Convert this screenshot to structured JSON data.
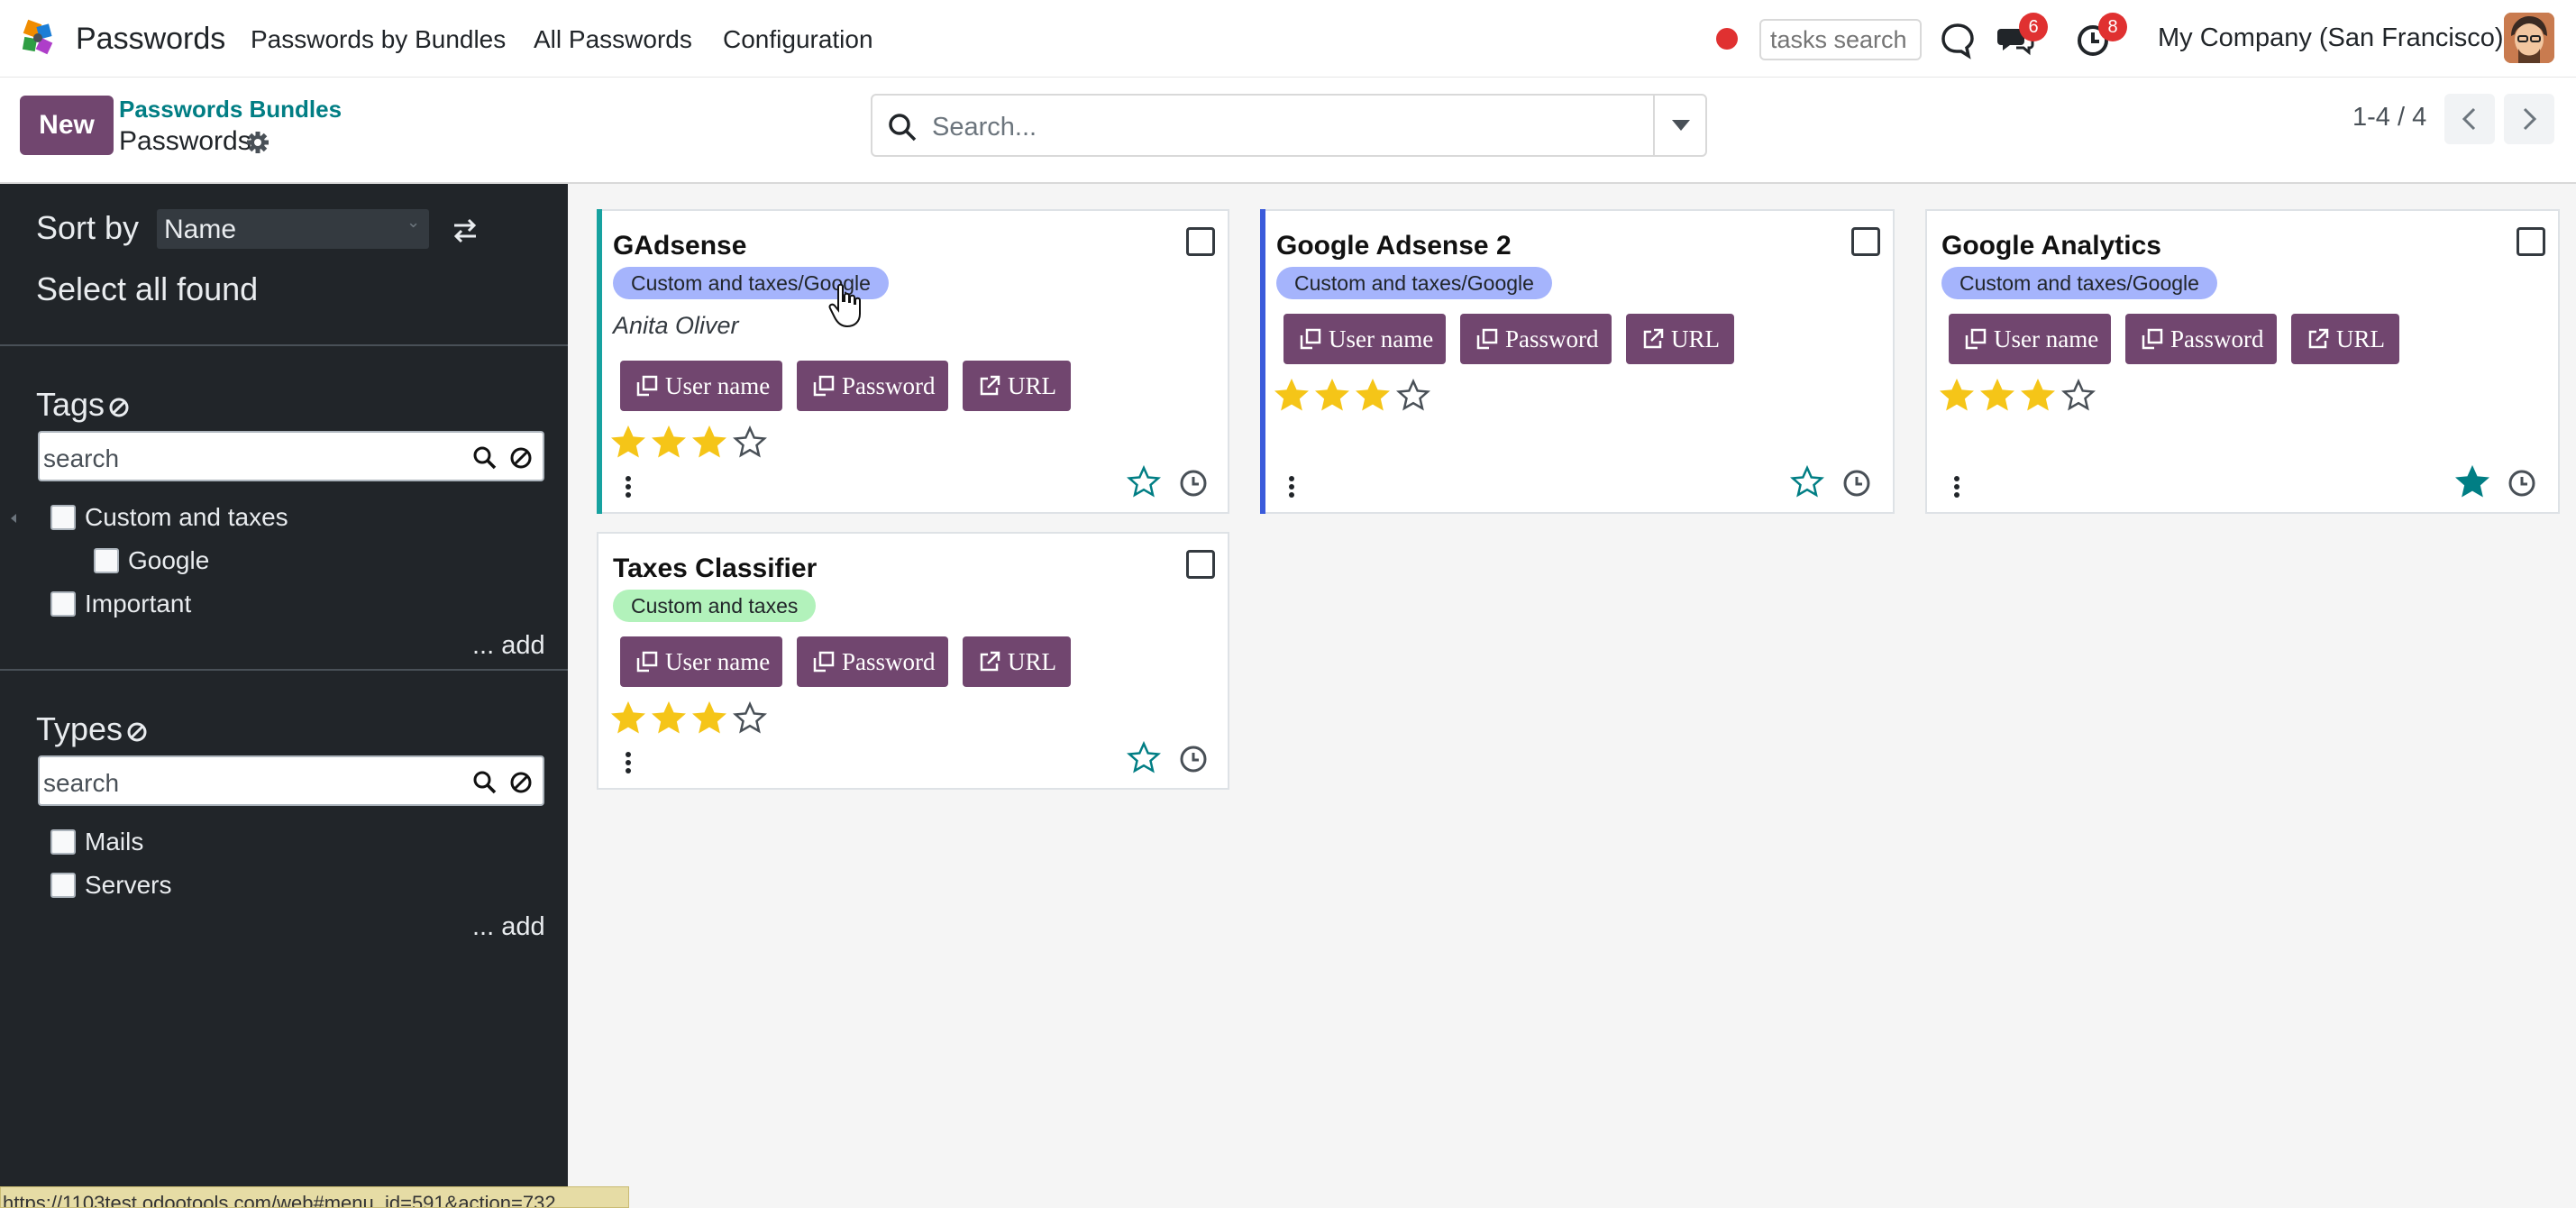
{
  "navbar": {
    "app_name": "Passwords",
    "menu": [
      "Passwords by Bundles",
      "All Passwords",
      "Configuration"
    ],
    "tasks_search_placeholder": "tasks search",
    "chat_badge": "6",
    "activity_badge": "8",
    "company": "My Company (San Francisco)",
    "icons": [
      "app-logo-icon",
      "record-dot-icon",
      "discuss-icon",
      "chat-icon",
      "activity-clock-icon",
      "user-avatar"
    ]
  },
  "control": {
    "new_label": "New",
    "breadcrumb_link": "Passwords Bundles",
    "breadcrumb_current": "Passwords",
    "search_placeholder": "Search...",
    "pager": "1-4 / 4"
  },
  "sidebar": {
    "sort_by": "Sort by",
    "sort_value": "Name",
    "select_all": "Select all found",
    "tags_title": "Tags",
    "tags_search_placeholder": "search",
    "tags": [
      "Custom and taxes",
      "Google",
      "Important"
    ],
    "add_label": "... add",
    "types_title": "Types",
    "types_search_placeholder": "search",
    "types": [
      "Mails",
      "Servers"
    ]
  },
  "cards": [
    {
      "title": "GAdsense",
      "tag": "Custom and taxes/Google",
      "owner": "Anita Oliver",
      "buttons": [
        "User name",
        "Password",
        "URL"
      ],
      "rating": 3,
      "rating_max": 4,
      "favorite": false,
      "accent": "#17a2a0"
    },
    {
      "title": "Google Adsense 2",
      "tag": "Custom and taxes/Google",
      "owner": "",
      "buttons": [
        "User name",
        "Password",
        "URL"
      ],
      "rating": 3,
      "rating_max": 4,
      "favorite": false,
      "accent": "#3b5bdb"
    },
    {
      "title": "Google Analytics",
      "tag": "Custom and taxes/Google",
      "owner": "",
      "buttons": [
        "User name",
        "Password",
        "URL"
      ],
      "rating": 3,
      "rating_max": 4,
      "favorite": true,
      "accent": ""
    },
    {
      "title": "Taxes Classifier",
      "tag": "Custom and taxes",
      "owner": "",
      "buttons": [
        "User name",
        "Password",
        "URL"
      ],
      "rating": 3,
      "rating_max": 4,
      "favorite": false,
      "accent": ""
    }
  ],
  "statusbar": {
    "url": "https://1103test.odootools.com/web#menu_id=591&action=732"
  },
  "colors": {
    "primary": "#71466f",
    "link": "#017e84",
    "sidebar_bg": "#212529",
    "star": "#f5c518",
    "badge": "#e03131"
  }
}
